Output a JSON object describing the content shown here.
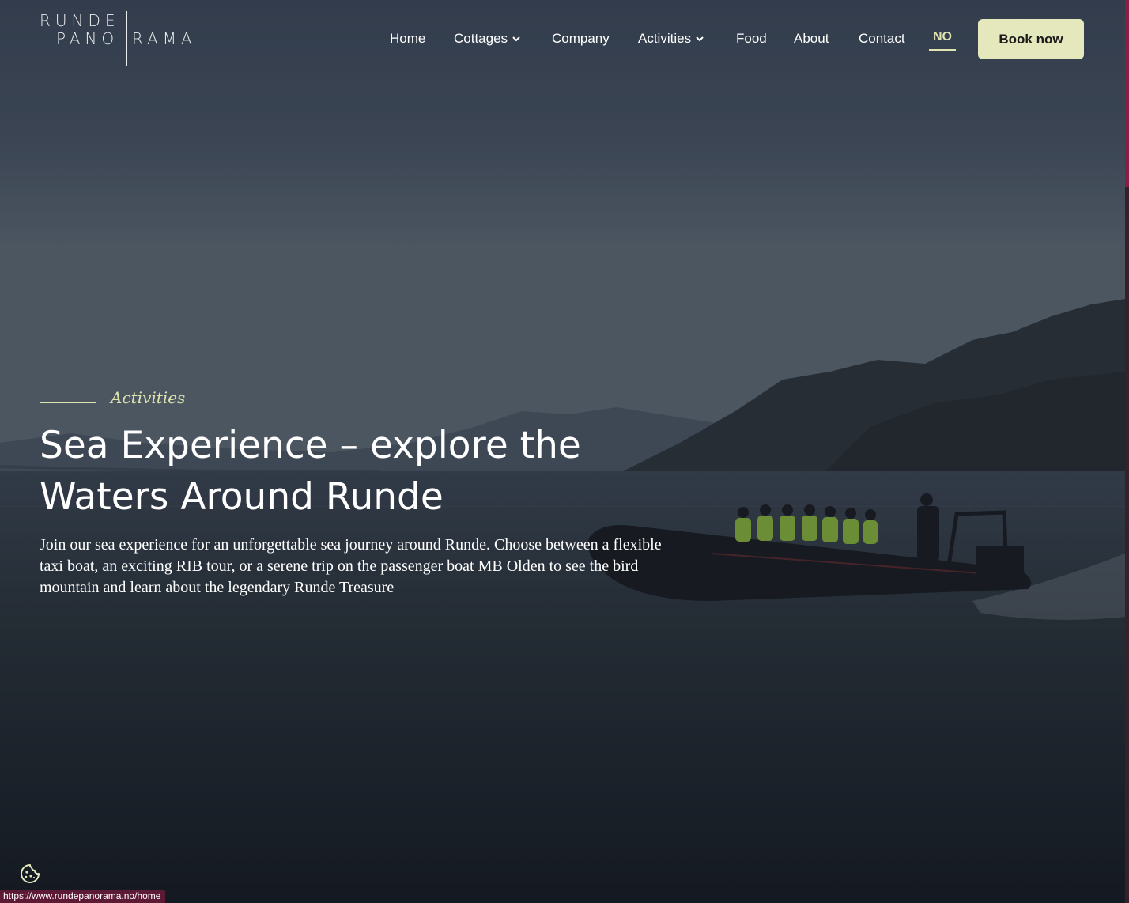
{
  "logo": {
    "line1": "RUNDE",
    "line2a": "PANO",
    "line2b": "RAMA"
  },
  "nav": {
    "items": [
      {
        "label": "Home"
      },
      {
        "label": "Cottages"
      },
      {
        "label": "Company"
      },
      {
        "label": "Activities"
      },
      {
        "label": "Food"
      },
      {
        "label": "About"
      },
      {
        "label": "Contact"
      }
    ],
    "language": "NO",
    "book_label": "Book now"
  },
  "hero": {
    "eyebrow": "Activities",
    "headline": "Sea Experience – explore the Waters Around Runde",
    "intro": "Join our sea experience for an unforgettable sea journey around Runde. Choose between a flexible taxi boat, an exciting RIB tour, or a serene trip on the passenger boat MB Olden to see the bird mountain and learn about the legendary Runde Treasure"
  },
  "status_bar": {
    "url": "https://www.rundepanorama.no/home"
  },
  "colors": {
    "accent": "#dfe3b0",
    "button_bg": "#e4e8bc",
    "brand_bar": "#9b1d4e"
  },
  "icons": {
    "cookie": "cookie-icon",
    "dropdown": "chevron-down-icon"
  }
}
